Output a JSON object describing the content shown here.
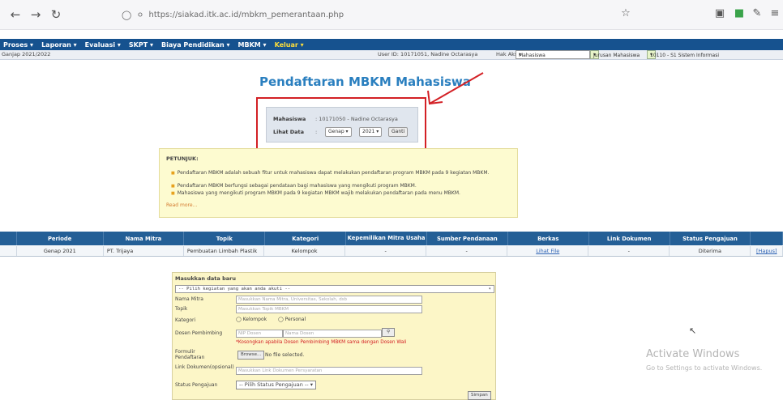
{
  "browser": {
    "url": "https://siakad.itk.ac.id/mbkm_pemerantaan.php",
    "back_icon": "arrow-left",
    "forward_icon": "arrow-right",
    "reload_icon": "reload",
    "star_icon": "star",
    "shield_color": "#3aa34a"
  },
  "menu": {
    "items": [
      "Proses",
      "Laporan",
      "Evaluasi",
      "SKPT",
      "Biaya Pendidikan",
      "MBKM",
      "Keluar"
    ],
    "highlight_color": "#ffdf3a",
    "bg_color": "#16528f"
  },
  "infobar": {
    "period_text": "Ganjap 2021/2022",
    "user_text": "User ID: 10171051, Nadine Octarasya",
    "access_label": "Hak Akses:",
    "access_value": "Mahasiswa",
    "jurusan_value": "Jurusan Mahasiswa",
    "prodi_value": "10110 - S1 Sistem Informasi"
  },
  "page": {
    "title": "Pendaftaran MBKM Mahasiswa"
  },
  "student": {
    "mahasiswa_label": "Mahasiswa",
    "mahasiswa_value": ": 10171050 - Nadine Octarasya",
    "lihat_label": "Lihat Data",
    "colon": ":",
    "semester_value": "Genap",
    "year_value": "2021",
    "button_label": "Ganti"
  },
  "hint": {
    "title": "PETUNJUK:",
    "items": [
      "Pendaftaran MBKM adalah sebuah fitur untuk mahasiswa dapat melakukan pendaftaran program MBKM pada 9 kegiatan MBKM.",
      "Pendaftaran MBKM berfungsi sebagai pendataan bagi mahasiswa yang mengikuti program MBKM.",
      "Mahasiswa yang mengikuti program MBKM pada 9 kegiatan MBKM wajib melakukan pendaftaran pada menu MBKM."
    ],
    "more": "Read more..."
  },
  "table": {
    "headers": [
      "",
      "Periode",
      "Nama Mitra",
      "Topik",
      "Kategori",
      "Kepemilikan Mitra Usaha",
      "Sumber Pendanaan",
      "Berkas",
      "Link Dokumen",
      "Status Pengajuan",
      ""
    ],
    "row": [
      "",
      "Genap 2021",
      "PT. Trijaya",
      "Pembuatan Limbah Plastik",
      "Kelompok",
      "-",
      "-",
      "Lihat File",
      "-",
      "Diterima",
      "[Hapus]"
    ]
  },
  "form": {
    "heading": "Masukkan data baru",
    "select_placeholder": "-- Pilih kegiatan yang akan anda akuti --",
    "nama_mitra_label": "Nama Mitra",
    "nama_mitra_placeholder": "Masukkan Nama Mitra, Universitas, Sekolah, dsb",
    "topik_label": "Topik",
    "topik_placeholder": "Masukkan Topik MBKM",
    "kategori_label": "Kategori",
    "kategori_option1": "Kelompok",
    "kategori_option2": "Personal",
    "dosen_label": "Dosen Pembimbing",
    "nip_placeholder": "NIP Dosen",
    "nama_dosen_placeholder": "Nama Dosen",
    "dosen_warning": "*Kosongkan apabila Dosen Pembimbing MBKM sama dengan Dosen Wali",
    "formulir_label": "Formulir Pendaftaran",
    "browse_label": "Browse...",
    "no_file": "No file selected.",
    "link_label": "Link Dokumen(opsional)",
    "link_placeholder": "Masukkan Link Dokumen Persyaratan",
    "status_label": "Status Pengajuan",
    "status_value": "-- Pilih Status Pengajuan --",
    "submit_label": "Simpan"
  },
  "windows": {
    "activate_title": "Activate Windows",
    "activate_sub": "Go to Settings to activate Windows."
  }
}
